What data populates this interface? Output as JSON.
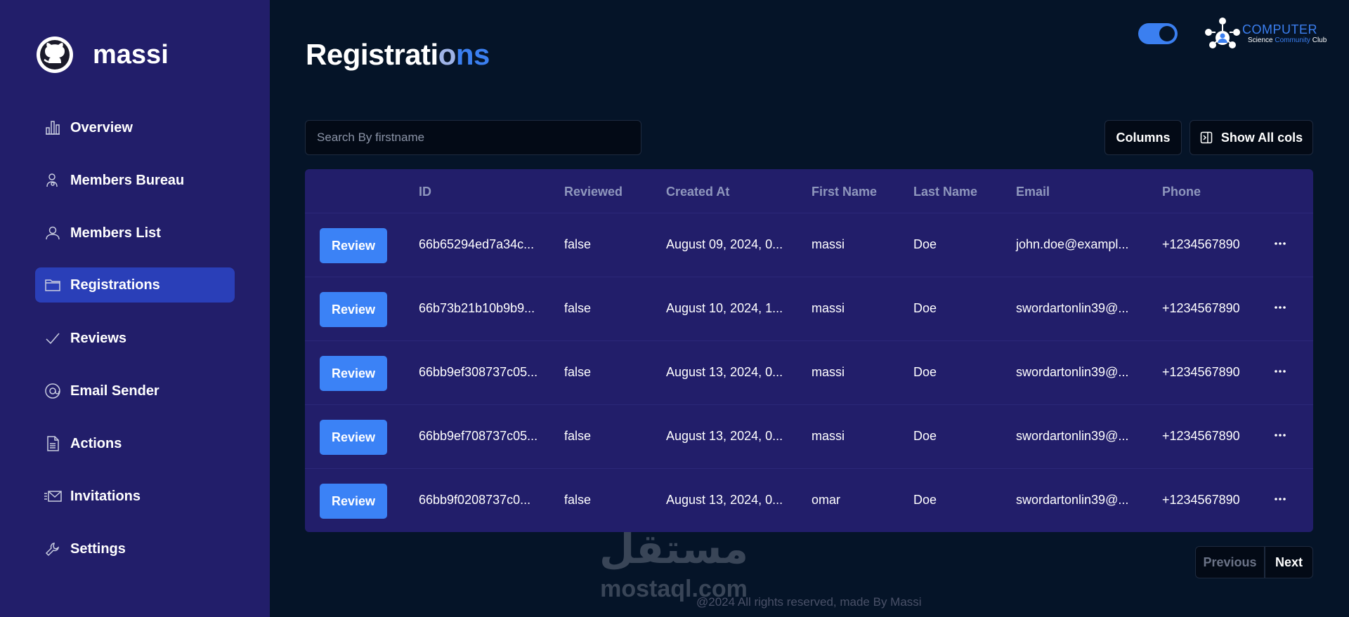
{
  "brand": {
    "name": "massi"
  },
  "sidebar": {
    "items": [
      {
        "label": "Overview",
        "icon": "bar-chart-icon",
        "active": false
      },
      {
        "label": "Members Bureau",
        "icon": "user-badge-icon",
        "active": false
      },
      {
        "label": "Members List",
        "icon": "user-icon",
        "active": false
      },
      {
        "label": "Registrations",
        "icon": "folder-icon",
        "active": true
      },
      {
        "label": "Reviews",
        "icon": "check-icon",
        "active": false
      },
      {
        "label": "Email Sender",
        "icon": "at-sign-icon",
        "active": false
      },
      {
        "label": "Actions",
        "icon": "document-icon",
        "active": false
      },
      {
        "label": "Invitations",
        "icon": "envelope-icon",
        "active": false
      },
      {
        "label": "Settings",
        "icon": "wrench-icon",
        "active": false
      }
    ]
  },
  "page": {
    "title_part1": "Registrati",
    "title_part2": "o",
    "title_part3": "ns"
  },
  "header": {
    "logo_word": "COMPUTER",
    "logo_sub_1": "Science ",
    "logo_sub_2": "Community",
    "logo_sub_3": " Club"
  },
  "search": {
    "placeholder": "Search By firstname",
    "value": ""
  },
  "toolbar": {
    "columns_label": "Columns",
    "show_all_label": "Show All cols"
  },
  "table": {
    "columns": [
      "ID",
      "Reviewed",
      "Created At",
      "First Name",
      "Last Name",
      "Email",
      "Phone"
    ],
    "review_label": "Review",
    "rows": [
      {
        "id": "66b65294ed7a34c...",
        "reviewed": "false",
        "created_at": "August 09, 2024, 0...",
        "first_name": "massi",
        "last_name": "Doe",
        "email": "john.doe@exampl...",
        "phone": "+1234567890"
      },
      {
        "id": "66b73b21b10b9b9...",
        "reviewed": "false",
        "created_at": "August 10, 2024, 1...",
        "first_name": "massi",
        "last_name": "Doe",
        "email": "swordartonlin39@...",
        "phone": "+1234567890"
      },
      {
        "id": "66bb9ef308737c05...",
        "reviewed": "false",
        "created_at": "August 13, 2024, 0...",
        "first_name": "massi",
        "last_name": "Doe",
        "email": "swordartonlin39@...",
        "phone": "+1234567890"
      },
      {
        "id": "66bb9ef708737c05...",
        "reviewed": "false",
        "created_at": "August 13, 2024, 0...",
        "first_name": "massi",
        "last_name": "Doe",
        "email": "swordartonlin39@...",
        "phone": "+1234567890"
      },
      {
        "id": "66bb9f0208737c0...",
        "reviewed": "false",
        "created_at": "August 13, 2024, 0...",
        "first_name": "omar",
        "last_name": "Doe",
        "email": "swordartonlin39@...",
        "phone": "+1234567890"
      }
    ]
  },
  "pagination": {
    "previous_label": "Previous",
    "next_label": "Next"
  },
  "footer": {
    "text": "@2024 All rights reserved, made By Massi"
  },
  "watermark": {
    "arabic": "مستقل",
    "latin": "mostaql.com"
  },
  "colors": {
    "sidebar_bg": "#221e6a",
    "page_bg": "#051428",
    "accent": "#3b82f6",
    "active_nav": "#2a3fb8"
  }
}
